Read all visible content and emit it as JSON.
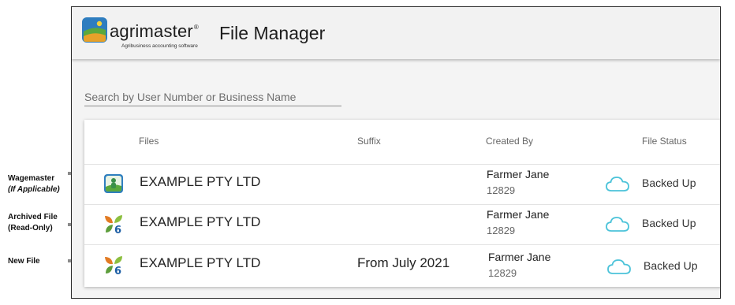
{
  "app": {
    "brand": "agrimaster",
    "registered_mark": "®",
    "tagline": "Agribusiness accounting software",
    "page_title": "File Manager"
  },
  "search": {
    "placeholder": "Search by User Number or Business Name",
    "value": ""
  },
  "table": {
    "headers": {
      "files": "Files",
      "suffix": "Suffix",
      "created_by": "Created By",
      "file_status": "File Status"
    },
    "rows": [
      {
        "icon": "wagemaster-icon",
        "name": "EXAMPLE PTY LTD",
        "suffix": "",
        "created_by": "Farmer Jane",
        "user_number": "12829",
        "status_icon": "cloud-icon",
        "status": "Backed Up"
      },
      {
        "icon": "agrimaster-6-icon",
        "name": "EXAMPLE PTY LTD",
        "suffix": "",
        "created_by": "Farmer Jane",
        "user_number": "12829",
        "status_icon": "cloud-icon",
        "status": "Backed Up"
      },
      {
        "icon": "agrimaster-6-icon",
        "name": "EXAMPLE PTY LTD",
        "suffix": "From July 2021",
        "created_by": "Farmer Jane",
        "user_number": "12829",
        "status_icon": "cloud-icon",
        "status": "Backed Up"
      }
    ]
  },
  "annotations": [
    {
      "line1": "Wagemaster",
      "line2": "(If Applicable)"
    },
    {
      "line1": "Archived File",
      "line2": "(Read-Only)"
    },
    {
      "line1": "New File",
      "line2": ""
    }
  ],
  "colors": {
    "cloud": "#4cc3d9",
    "appbar": "#f2f2f2",
    "leaf_orange": "#e27b23",
    "leaf_green": "#5d9e3c",
    "six_blue": "#1d5fa5"
  }
}
